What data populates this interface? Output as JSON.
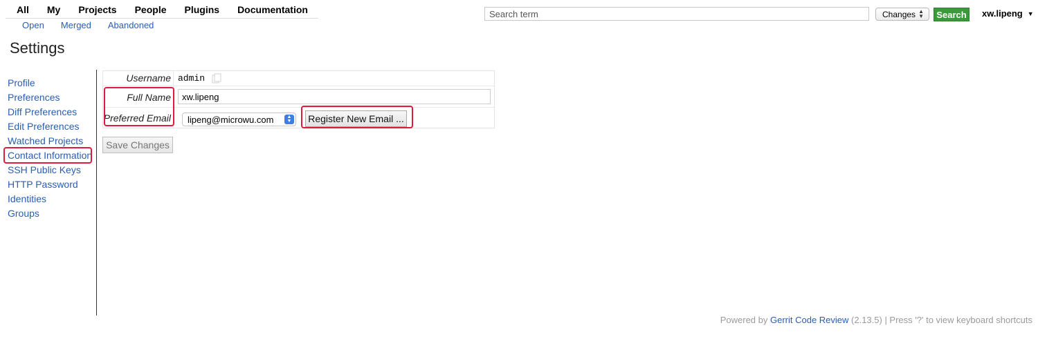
{
  "top_nav": {
    "items": [
      "All",
      "My",
      "Projects",
      "People",
      "Plugins",
      "Documentation"
    ],
    "sub_items": [
      "Open",
      "Merged",
      "Abandoned"
    ]
  },
  "search": {
    "placeholder": "Search term",
    "scope": "Changes",
    "button_label": "Search"
  },
  "user": {
    "name": "xw.lipeng"
  },
  "page": {
    "title": "Settings"
  },
  "sidebar": {
    "items": [
      {
        "label": "Profile"
      },
      {
        "label": "Preferences"
      },
      {
        "label": "Diff Preferences"
      },
      {
        "label": "Edit Preferences"
      },
      {
        "label": "Watched Projects"
      },
      {
        "label": "Contact Information",
        "selected": true
      },
      {
        "label": "SSH Public Keys"
      },
      {
        "label": "HTTP Password"
      },
      {
        "label": "Identities"
      },
      {
        "label": "Groups"
      }
    ]
  },
  "contact_form": {
    "username_label": "Username",
    "username_value": "admin",
    "fullname_label": "Full Name",
    "fullname_value": "xw.lipeng",
    "email_label": "Preferred Email",
    "email_value": "lipeng@microwu.com",
    "register_label": "Register New Email ...",
    "save_label": "Save Changes"
  },
  "footer": {
    "prefix": "Powered by ",
    "link": "Gerrit Code Review",
    "suffix": " (2.13.5) | Press '?' to view keyboard shortcuts"
  },
  "colors": {
    "link": "#2a5db0",
    "search_button": "#3a9a3a",
    "highlight": "#e0193d"
  }
}
